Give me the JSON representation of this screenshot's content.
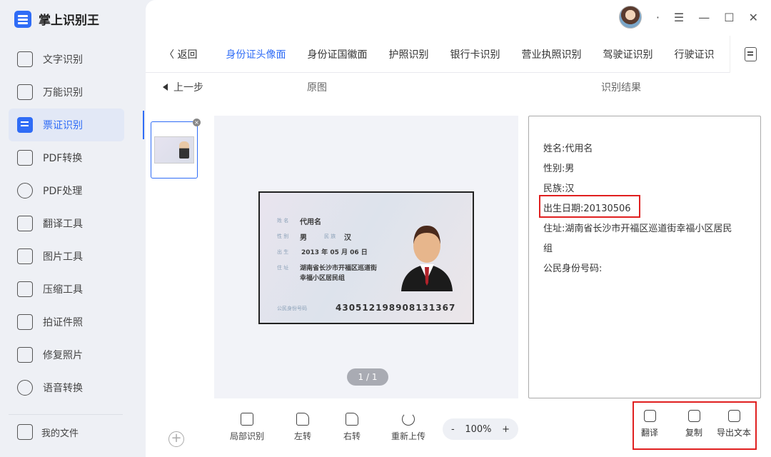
{
  "app": {
    "title": "掌上识别王"
  },
  "sidebar": {
    "items": [
      {
        "label": "文字识别",
        "icon": "text-recognition-icon"
      },
      {
        "label": "万能识别",
        "icon": "universal-recognition-icon"
      },
      {
        "label": "票证识别",
        "icon": "certificate-recognition-icon",
        "active": true
      },
      {
        "label": "PDF转换",
        "icon": "pdf-convert-icon"
      },
      {
        "label": "PDF处理",
        "icon": "pdf-process-icon"
      },
      {
        "label": "翻译工具",
        "icon": "translate-tool-icon"
      },
      {
        "label": "图片工具",
        "icon": "image-tool-icon"
      },
      {
        "label": "压缩工具",
        "icon": "compress-tool-icon"
      },
      {
        "label": "拍证件照",
        "icon": "id-photo-icon"
      },
      {
        "label": "修复照片",
        "icon": "repair-photo-icon"
      },
      {
        "label": "语音转换",
        "icon": "voice-convert-icon"
      }
    ],
    "my_files": "我的文件"
  },
  "window": {
    "menu_dot": "·",
    "menu": "☰",
    "minimize": "—",
    "maximize": "☐",
    "close": "✕"
  },
  "tabs": {
    "back": "〈 返回",
    "items": [
      "身份证头像面",
      "身份证国徽面",
      "护照识别",
      "银行卡识别",
      "营业执照识别",
      "驾驶证识别",
      "行驶证识"
    ],
    "active_index": 0
  },
  "subheader": {
    "prev": "上一步",
    "original": "原图",
    "result": "识别结果"
  },
  "id_card": {
    "name_label": "姓 名",
    "name": "代用名",
    "sex_label": "性 别",
    "sex": "男",
    "nation_label": "民 族",
    "nation": "汉",
    "birth_label": "出 生",
    "birth": "2013  年 05 月 06 日",
    "addr_label": "住 址",
    "addr1": "湖南省长沙市开福区巡道街",
    "addr2": "幸福小区居民组",
    "id_label": "公民身份号码",
    "id_number": "430512198908131367"
  },
  "pager": "1 / 1",
  "result": {
    "lines": [
      "姓名:代用名",
      "性别:男",
      "民族:汉",
      "出生日期:20130506",
      "住址:湖南省长沙市开福区巡道街幸福小区居民",
      "组",
      "公民身份号码:"
    ],
    "highlighted_index": 3
  },
  "toolbar": {
    "partial": "局部识别",
    "rotate_left": "左转",
    "rotate_right": "右转",
    "reupload": "重新上传"
  },
  "zoom": {
    "minus": "-",
    "value": "100%",
    "plus": "+"
  },
  "actions": {
    "translate": "翻译",
    "copy": "复制",
    "export": "导出文本"
  },
  "colors": {
    "accent": "#2f6cf6",
    "highlight": "#e02020"
  }
}
